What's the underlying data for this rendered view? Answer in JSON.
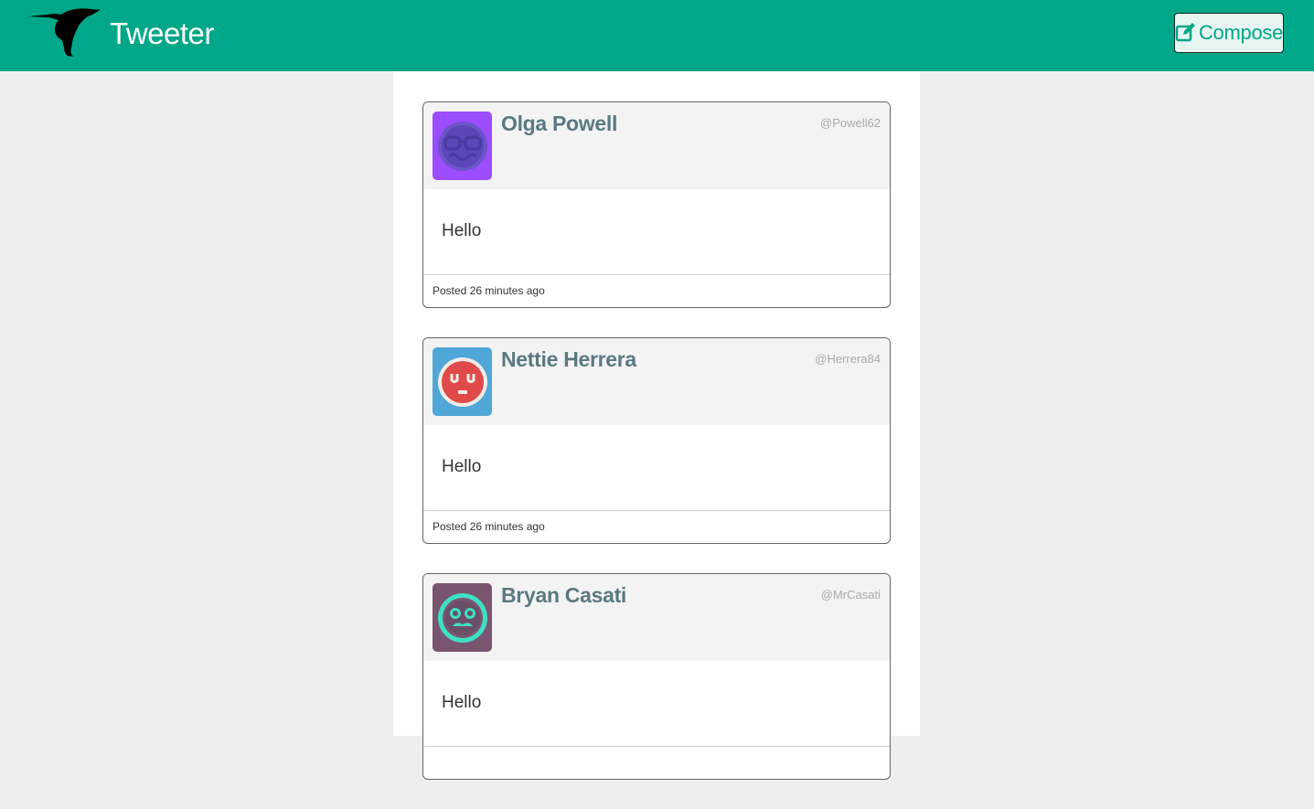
{
  "header": {
    "brand": "Tweeter",
    "compose_label": "Compose",
    "colors": {
      "accent": "#00a788",
      "button_bg": "#e7f5f1"
    }
  },
  "tweets": [
    {
      "name": "Olga Powell",
      "handle": "@Powell62",
      "text": "Hello",
      "posted": "Posted 26 minutes ago",
      "avatar_bg": "#9b4dff",
      "avatar_icon": "face-sunglasses-icon"
    },
    {
      "name": "Nettie Herrera",
      "handle": "@Herrera84",
      "text": "Hello",
      "posted": "Posted 26 minutes ago",
      "avatar_bg": "#4fa7d8",
      "avatar_icon": "face-sleepy-icon"
    },
    {
      "name": "Bryan Casati",
      "handle": "@MrCasati",
      "text": "Hello",
      "posted": "",
      "avatar_bg": "#7a5570",
      "avatar_icon": "face-mustache-icon"
    }
  ]
}
